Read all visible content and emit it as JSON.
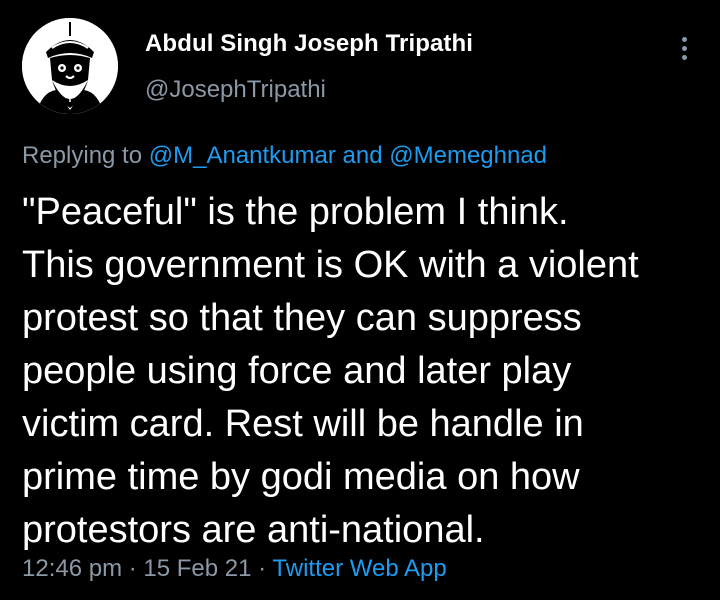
{
  "author": {
    "name": "Abdul Singh Joseph Tripathi",
    "handle": "@JosephTripathi"
  },
  "reply": {
    "prefix": "Replying to ",
    "mention1": "@M_Anantkumar",
    "conjunction": " and ",
    "mention2": "@Memeghnad"
  },
  "tweet": {
    "text": "\"Peaceful\" is the problem I think.\nThis government is OK with a violent\nprotest so that they can suppress\npeople using force and later play\nvictim card. Rest will be handle in\nprime time by godi media on how\nprotestors are anti-national."
  },
  "meta": {
    "time": "12:46 pm",
    "sep1": " · ",
    "date": "15 Feb 21",
    "sep2": " · ",
    "source": "Twitter Web App"
  },
  "icons": {
    "more": "more-vertical-icon",
    "avatar": "avatar"
  },
  "colors": {
    "background": "#000000",
    "text": "#ffffff",
    "secondary": "#8b98a5",
    "link": "#1d9bf0"
  }
}
